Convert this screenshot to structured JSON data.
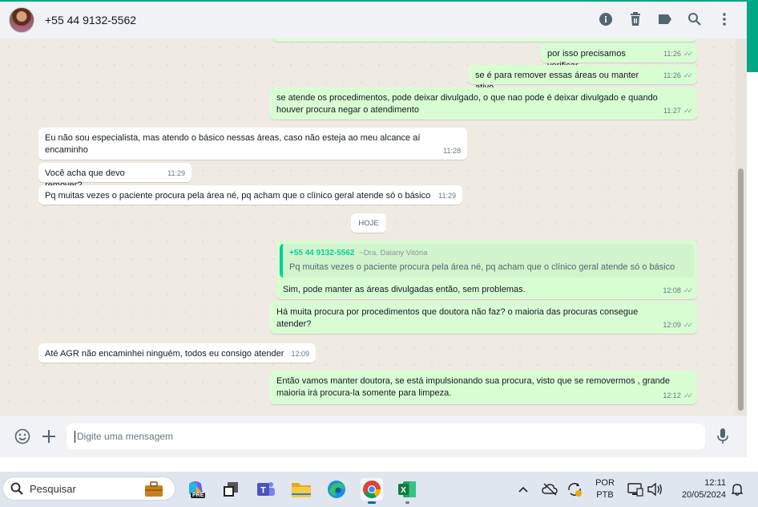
{
  "header": {
    "contact": "+55 44 9132-5562",
    "icons": [
      "info-icon",
      "trash-icon",
      "label-icon",
      "search-icon",
      "menu-icon"
    ]
  },
  "messages": [
    {
      "dir": "out",
      "text": "por isso precisamos verificar",
      "time": "11:26"
    },
    {
      "dir": "out",
      "text": "se é para remover essas áreas ou manter ativo",
      "time": "11:26"
    },
    {
      "dir": "out",
      "text": "se atende os procedimentos, pode deixar divulgado, o que nao pode é deixar divulgado e quando houver procura negar o atendimento",
      "time": "11:27"
    },
    {
      "dir": "in",
      "text": "Eu não sou especialista, mas atendo o básico nessas áreas, caso não esteja ao meu alcance aí encaminho",
      "time": "11:28"
    },
    {
      "dir": "in",
      "text": "Você acha que devo remover?",
      "time": "11:29"
    },
    {
      "dir": "in",
      "text": "Pq muitas vezes o paciente procura pela área né, pq acham que o clínico geral atende só o básico",
      "time": "11:29"
    },
    {
      "dir": "out",
      "text": "Sim, pode manter as áreas divulgadas então, sem problemas.",
      "time": "12:08",
      "quote": {
        "name": "+55 44 9132-5562",
        "push": "~Dra. Daiany Vitória",
        "text": "Pq muitas vezes o paciente procura pela área né, pq acham que o clínico geral atende só o básico"
      }
    },
    {
      "dir": "out",
      "text": "Há muita procura por procedimentos que doutora não faz? o maioria das procuras consegue atender?",
      "time": "12:09"
    },
    {
      "dir": "in",
      "text": "Até AGR não encaminhei ninguém, todos eu consigo atender",
      "time": "12:09"
    },
    {
      "dir": "out",
      "text": "Então vamos manter doutora, se está impulsionando sua procura, visto que se removermos , grande maioria irá procura-la somente para limpeza.",
      "time": "12:12"
    }
  ],
  "day_divider": "HOJE",
  "ticks": "✓✓",
  "composer": {
    "placeholder": "Digite uma mensagem",
    "icons": [
      "emoji-icon",
      "plus-icon",
      "microphone-icon"
    ]
  },
  "taskbar": {
    "search_label": "Pesquisar",
    "apps": [
      "briefcase-icon",
      "copilot-icon",
      "task-view-icon",
      "teams-icon",
      "file-explorer-icon",
      "edge-icon",
      "chrome-icon",
      "excel-icon"
    ],
    "copilot_badge": "PRE",
    "lang_top": "POR",
    "lang_bottom": "PTB",
    "time": "12:11",
    "date": "20/05/2024"
  },
  "colors": {
    "accent": "#00a884",
    "outgoing_bubble": "#d9fdd3",
    "incoming_bubble": "#ffffff",
    "chat_bg": "#efeae2",
    "quote_bar": "#06cf9c"
  }
}
